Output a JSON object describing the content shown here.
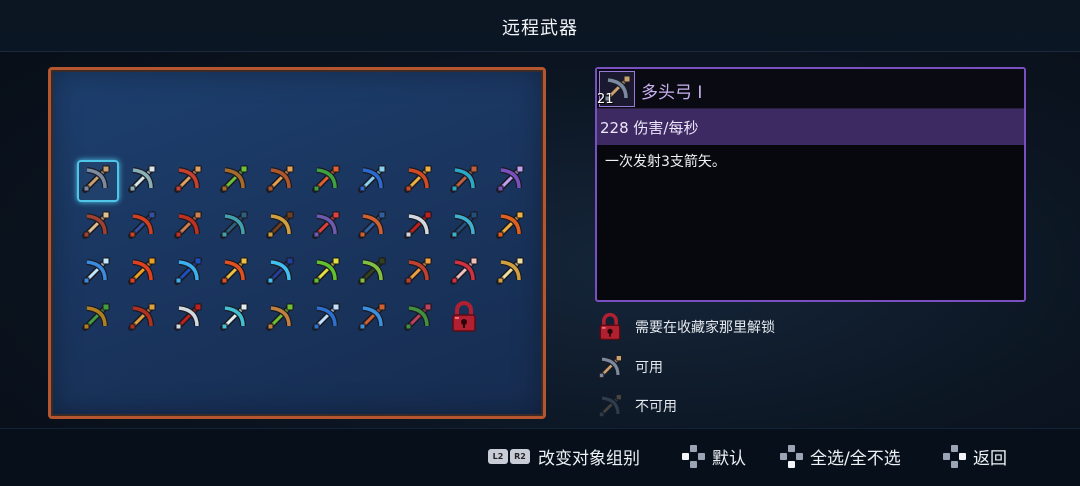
{
  "title": "远程武器",
  "grid": {
    "icons": [
      {
        "icon": "multiple-nocks-bow-icon",
        "colors": [
          "#7a8aa0",
          "#c9a070"
        ]
      },
      {
        "icon": "ice-bow-icon",
        "colors": [
          "#8ab0b8",
          "#d6e6ea"
        ]
      },
      {
        "icon": "red-bow-icon",
        "colors": [
          "#c64030",
          "#e0a060"
        ]
      },
      {
        "icon": "green-crossbow-icon",
        "colors": [
          "#a66b2a",
          "#6ec23a"
        ]
      },
      {
        "icon": "orange-bow-icon",
        "colors": [
          "#b0562c",
          "#e8a050"
        ]
      },
      {
        "icon": "green-bow-icon",
        "colors": [
          "#3ea040",
          "#e06030"
        ]
      },
      {
        "icon": "blue-bow-icon",
        "colors": [
          "#2a6ad0",
          "#8ad0f0"
        ]
      },
      {
        "icon": "fire-bow-icon",
        "colors": [
          "#d04a24",
          "#f0b040"
        ]
      },
      {
        "icon": "cyan-bow-icon",
        "colors": [
          "#2aa8c8",
          "#c06040"
        ]
      },
      {
        "icon": "purple-crossbow-icon",
        "colors": [
          "#7a50c0",
          "#c0a0f0"
        ]
      },
      {
        "icon": "heavy-crossbow-icon",
        "colors": [
          "#a04030",
          "#e0c090"
        ]
      },
      {
        "icon": "boomerang-icon",
        "colors": [
          "#d04020",
          "#3050a0"
        ]
      },
      {
        "icon": "pickaxe-icon",
        "colors": [
          "#c03020",
          "#d08050"
        ]
      },
      {
        "icon": "throwing-axe-icon",
        "colors": [
          "#40a0b0",
          "#2a6080"
        ]
      },
      {
        "icon": "spear-icon",
        "colors": [
          "#d0a040",
          "#704020"
        ]
      },
      {
        "icon": "magic-crossbow-icon",
        "colors": [
          "#6a5ab0",
          "#e04040"
        ]
      },
      {
        "icon": "orange-crossbow-icon",
        "colors": [
          "#d06030",
          "#3060a0"
        ]
      },
      {
        "icon": "throwing-knife-icon",
        "colors": [
          "#d0d8e0",
          "#c02020"
        ]
      },
      {
        "icon": "whip-icon",
        "colors": [
          "#40b0d0",
          "#205080"
        ]
      },
      {
        "icon": "fire-ring-icon",
        "colors": [
          "#e06020",
          "#f0b040"
        ]
      },
      {
        "icon": "ice-shard-icon",
        "colors": [
          "#3a8ae0",
          "#c0e8ff"
        ]
      },
      {
        "icon": "fireball-icon",
        "colors": [
          "#e04020",
          "#f0a020"
        ]
      },
      {
        "icon": "lightning-icon",
        "colors": [
          "#3ab0f0",
          "#1a50c0"
        ]
      },
      {
        "icon": "fire-blast-icon",
        "colors": [
          "#e05020",
          "#f0c040"
        ]
      },
      {
        "icon": "ice-blast-icon",
        "colors": [
          "#40c0f0",
          "#2040a0"
        ]
      },
      {
        "icon": "poison-blast-icon",
        "colors": [
          "#60c030",
          "#e0e040"
        ]
      },
      {
        "icon": "magic-staff-icon",
        "colors": [
          "#80c040",
          "#304020"
        ]
      },
      {
        "icon": "dragon-claw-icon",
        "colors": [
          "#c04030",
          "#f0a040"
        ]
      },
      {
        "icon": "cards-icon",
        "colors": [
          "#d03040",
          "#f0c0c0"
        ]
      },
      {
        "icon": "gold-crossbow-icon",
        "colors": [
          "#d0a040",
          "#f0e0a0"
        ]
      },
      {
        "icon": "shield-bow-icon",
        "colors": [
          "#b08020",
          "#40a040"
        ]
      },
      {
        "icon": "ember-bow-icon",
        "colors": [
          "#b03020",
          "#e0a040"
        ]
      },
      {
        "icon": "cleaver-icon",
        "colors": [
          "#d0d8e0",
          "#c02020"
        ]
      },
      {
        "icon": "hook-icon",
        "colors": [
          "#40c0d0",
          "#e0f0f0"
        ]
      },
      {
        "icon": "scroll-icon",
        "colors": [
          "#c08040",
          "#70c030"
        ]
      },
      {
        "icon": "shuriken-icon",
        "colors": [
          "#2a70d0",
          "#c0e0ff"
        ]
      },
      {
        "icon": "chakram-icon",
        "colors": [
          "#3a90e0",
          "#d06030"
        ]
      },
      {
        "icon": "tentacle-icon",
        "colors": [
          "#409040",
          "#c04060"
        ]
      },
      {
        "icon": "lock-icon",
        "colors": [
          "#b02030",
          "#f07080"
        ]
      }
    ],
    "selected_index": 0
  },
  "detail": {
    "count": "21",
    "name": "多头弓 I",
    "stat": "228 伤害/每秒",
    "description": "一次发射3支箭矢。",
    "icon": "multiple-nocks-bow-icon"
  },
  "legend": [
    {
      "icon": "lock-icon",
      "label": "需要在收藏家那里解锁"
    },
    {
      "icon": "multiple-nocks-bow-icon",
      "label": "可用"
    },
    {
      "icon": "dimmed-bow-icon",
      "label": "不可用"
    }
  ],
  "footer": {
    "l2_key": "L2",
    "r2_key": "R2",
    "change_group": "改变对象组别",
    "default": "默认",
    "select_all": "全选/全不选",
    "back": "返回"
  },
  "colors": {
    "panel_border": "#b5562e",
    "detail_border": "#7a4fc0",
    "selection": "#4fc6e8",
    "stat_bar": "#3d2a62"
  }
}
